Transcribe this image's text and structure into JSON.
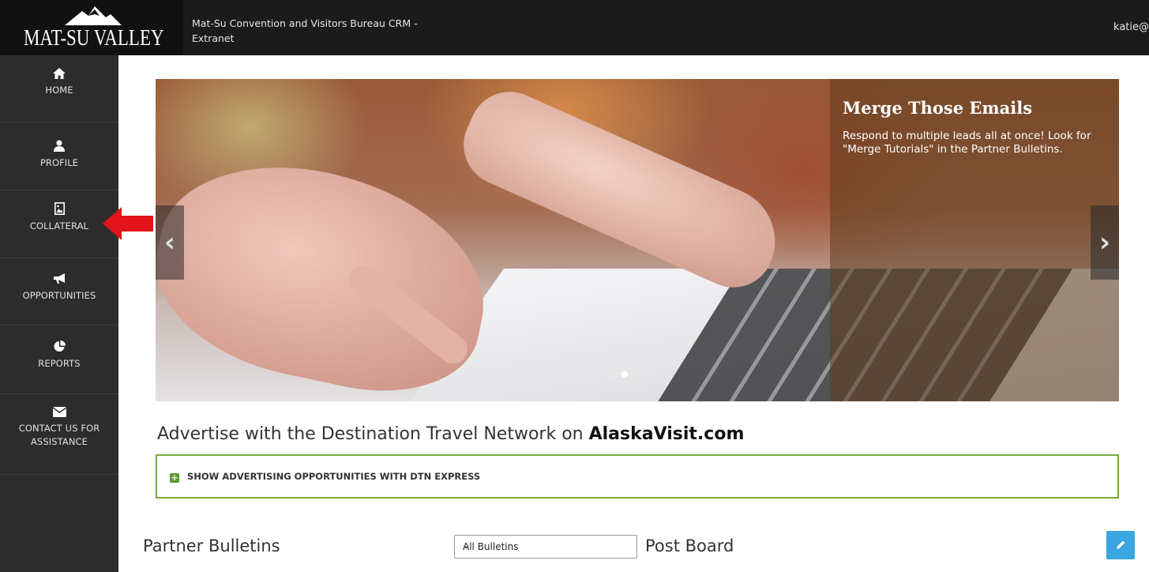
{
  "header": {
    "logo_text": "MAT-SU VALLEY",
    "app_title": "Mat-Su Convention and Visitors Bureau CRM - Extranet",
    "user": "katie@"
  },
  "sidebar": {
    "items": [
      {
        "label": "HOME",
        "icon": "home-icon"
      },
      {
        "label": "PROFILE",
        "icon": "user-icon"
      },
      {
        "label": "COLLATERAL",
        "icon": "image-file-icon"
      },
      {
        "label": "OPPORTUNITIES",
        "icon": "bullhorn-icon"
      },
      {
        "label": "REPORTS",
        "icon": "pie-chart-icon"
      },
      {
        "label": "CONTACT US FOR ASSISTANCE",
        "icon": "envelope-icon"
      }
    ]
  },
  "carousel": {
    "caption_title": "Merge Those Emails",
    "caption_text": "Respond to multiple leads all at once! Look for \"Merge Tutorials\" in the Partner Bulletins.",
    "prev_glyph": "‹",
    "next_glyph": "›"
  },
  "advertise": {
    "heading_prefix": "Advertise with the Destination Travel Network on ",
    "heading_brand": "AlaskaVisit.com",
    "toggle_label": "SHOW ADVERTISING OPPORTUNITIES WITH DTN EXPRESS"
  },
  "bulletins": {
    "title": "Partner Bulletins",
    "filter_selected": "All Bulletins",
    "post_board_title": "Post Board"
  },
  "colors": {
    "accent_green": "#7aa83f",
    "edit_blue": "#3aa7e0",
    "arrow_red": "#e3151a"
  }
}
